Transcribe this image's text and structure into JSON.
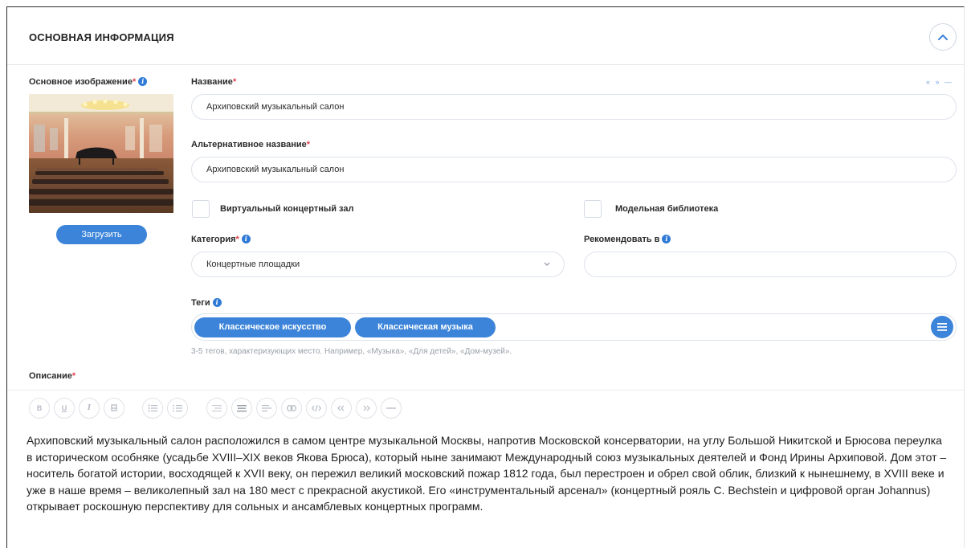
{
  "section": {
    "title": "ОСНОВНАЯ ИНФОРМАЦИЯ"
  },
  "main_image": {
    "label": "Основное изображение",
    "required_mark": "*",
    "upload_label": "Загрузить"
  },
  "name": {
    "label": "Название",
    "required_mark": "*",
    "value": "Архиповский музыкальный салон",
    "lang_links": "« » —"
  },
  "alt_name": {
    "label": "Альтернативное название",
    "required_mark": "*",
    "value": "Архиповский музыкальный салон"
  },
  "checkboxes": {
    "virtual_hall": "Виртуальный концертный зал",
    "model_library": "Модельная библиотека"
  },
  "category": {
    "label": "Категория",
    "required_mark": "*",
    "value": "Концертные площадки"
  },
  "recommend": {
    "label": "Рекомендовать в",
    "value": ""
  },
  "tags": {
    "label": "Теги",
    "items": [
      "Классическое искусство",
      "Классическая музыка"
    ],
    "hint": "3-5 тегов, характеризующих место. Например, «Музыка», «Для детей», «Дом-музей»."
  },
  "description": {
    "label": "Описание",
    "required_mark": "*",
    "toolbar": {
      "bold": "B",
      "underline": "U",
      "italic": "I"
    },
    "text": "Архиповский музыкальный салон расположился в самом центре музыкальной Москвы, напротив Московской консерватории, на углу Большой Никитской и Брюсова переулка в историческом особняке (усадьбе XVIII–XIX веков Якова Брюса), который ныне занимают Международный союз музыкальных деятелей и Фонд Ирины Архиповой. Дом этот – носитель богатой истории, восходящей к XVII веку, он пережил великий московский пожар 1812 года, был перестроен и обрел свой облик, близкий к нынешнему, в XVIII веке и уже в наше время – великолепный зал на 180 мест с прекрасной акустикой. Его «инструментальный арсенал» (концертный рояль C. Bechstein и цифровой орган Johannus) открывает роскошную перспективу для сольных и ансамблевых концертных программ."
  },
  "colors": {
    "accent": "#3b84d9",
    "required": "#e0424b",
    "border": "#dde2ea"
  }
}
